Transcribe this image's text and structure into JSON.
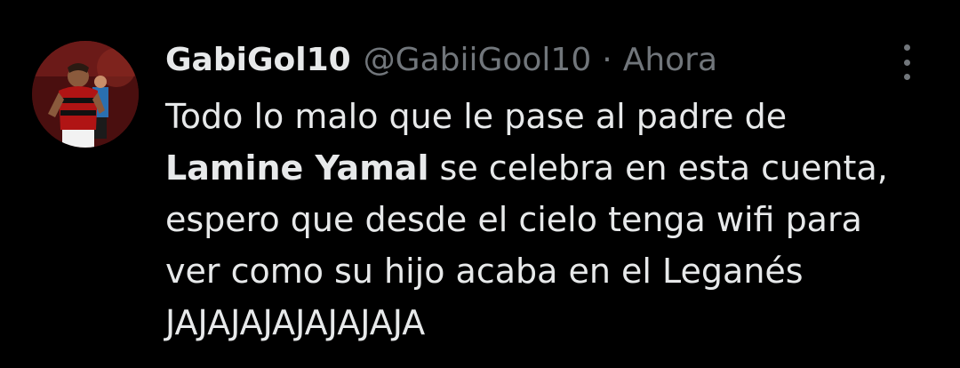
{
  "tweet": {
    "author": {
      "display_name": "GabiGol10",
      "handle": "@GabiiGool10"
    },
    "separator": "·",
    "timestamp": "Ahora",
    "more_icon": "more-vertical-icon",
    "text": {
      "line1": "Todo lo malo que le pase al padre de",
      "line2_bold": "Lamine Yamal",
      "line2_rest": " se celebra en esta cuenta,",
      "line3": "espero que desde el cielo tenga wifi para",
      "line4": "ver como su hijo acaba en el Leganés",
      "line5": "JAJAJAJAJAJAJAJA"
    }
  },
  "colors": {
    "background": "#000000",
    "primary_text": "#e7e9ea",
    "secondary_text": "#71767b"
  }
}
